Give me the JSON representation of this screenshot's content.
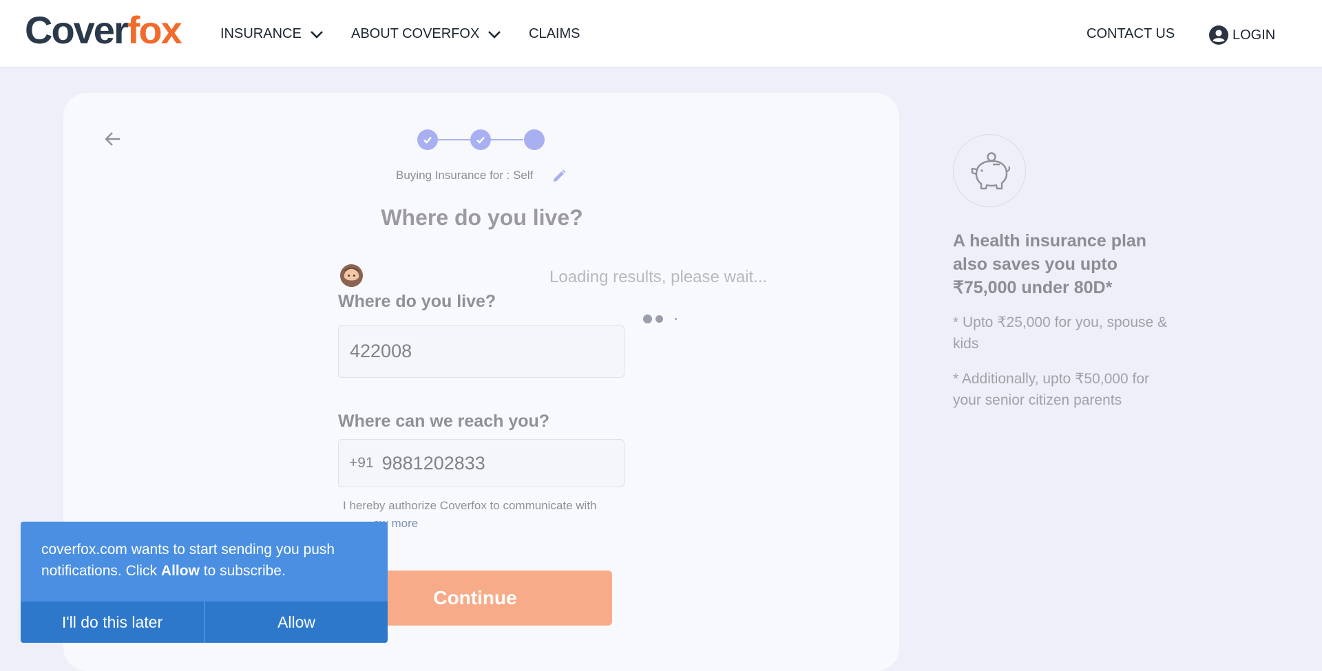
{
  "header": {
    "logo_part1": "Cover",
    "logo_part2": "fox",
    "nav": {
      "insurance": "INSURANCE",
      "about": "ABOUT COVERFOX",
      "claims": "CLAIMS",
      "contact": "CONTACT US",
      "login": "LOGIN"
    }
  },
  "form": {
    "buying_for": "Buying Insurance for : Self",
    "heading": "Where do you live?",
    "loading_text": "Loading results, please wait...",
    "pincode_label": "Where do you live?",
    "pincode_value": "422008",
    "phone_label": "Where can we reach you?",
    "country_code": "+91",
    "phone_value": "9881202833",
    "consent_text": "I hereby authorize Coverfox to communicate with",
    "know_more": "ow more",
    "continue_label": "Continue"
  },
  "sidebar": {
    "headline": "A health insurance plan also saves you upto ₹75,000 under 80D*",
    "note1": "* Upto ₹25,000 for you, spouse & kids",
    "note2": "* Additionally, upto ₹50,000 for your senior citizen parents"
  },
  "notification": {
    "message_part1": "coverfox.com wants to start sending you push notifications. Click ",
    "message_bold": "Allow",
    "message_part2": " to subscribe.",
    "later_label": "I'll do this later",
    "allow_label": "Allow"
  },
  "icons": [
    "chevron-down-icon",
    "user-circle-icon",
    "back-arrow-icon",
    "check-icon",
    "pencil-icon",
    "avatar-icon",
    "piggy-bank-icon"
  ],
  "colors": {
    "brand_dark": "#2b3a4a",
    "brand_orange": "#f26b2a",
    "step_color": "#a9b0f1",
    "continue_button": "#f8ab88",
    "notification_bg": "#4a8fe2"
  }
}
